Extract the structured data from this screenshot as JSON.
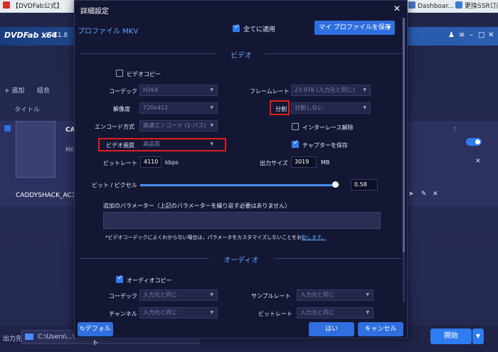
{
  "browser_tabs": [
    {
      "label": "【DVDFab公式】",
      "color": "#d93025"
    },
    {
      "label": "Dashboar...",
      "color": "#4a74c9"
    },
    {
      "label": "更換SSR订阅地",
      "color": "#3b7bd8"
    }
  ],
  "app": {
    "name": "DVDFab x64",
    "version": "12.0.1.8",
    "toolbar": {
      "add_label": "+ 追加",
      "merge_label": "結合"
    },
    "title_column": "タイトル",
    "job": {
      "short_name": "CA",
      "mk_label": "MK",
      "full_name": "CADDYSHACK_AC3_1",
      "side_number": "7"
    },
    "footer": {
      "output_label": "出力先",
      "path": "C:\\Users\\...\\Documents\\DVDFab\\DVDFab12\\",
      "start_label": "開始"
    }
  },
  "dialog": {
    "title": "詳細設定",
    "profile_label": "プロファイル MKV",
    "apply_all_label": "全てに適用",
    "apply_all_checked": true,
    "save_profile_label": "マイ プロファイルを保存",
    "video_section": "ビデオ",
    "video_copy_label": "ビデオコピー",
    "video_copy_checked": false,
    "codec_label": "コーデック",
    "codec_value": "H264",
    "frame_rate_label": "フレームレート",
    "frame_rate_value": "23.976 (入力元と同じ)",
    "resolution_label": "解像度",
    "resolution_value": "720x412",
    "split_label": "分割",
    "split_value": "分割しない",
    "encode_label": "エンコード方式",
    "encode_value": "高速エンコード (1-パス)",
    "deinterlace_label": "インターレース解除",
    "deinterlace_checked": false,
    "quality_label": "ビデオ画質",
    "quality_value": "高品質",
    "chapter_label": "チャプターを保存",
    "chapter_checked": true,
    "bitrate_label": "ビットレート",
    "bitrate_value": "4110",
    "bitrate_unit": "kbps",
    "output_size_label": "出力サイズ",
    "output_size_value": "3019",
    "output_size_unit": "MB",
    "bits_per_pixel_label": "ビット / ピクセル",
    "bits_per_pixel_value": "0.58",
    "bits_per_pixel_fraction": 0.98,
    "extra_params_label": "追加のパラメーター（上記のパラメーターを繰り返す必要はありません）",
    "extra_params_value": "",
    "note_text": "*ビデオコーデックによくわからない場合は，パラメータをカスタマイズしないことをお",
    "note_link": "勧します。",
    "audio_section": "オーディオ",
    "audio_copy_label": "オーディオコピー",
    "audio_copy_checked": true,
    "audio_codec_label": "コーデック",
    "audio_codec_value": "入力元と同じ",
    "sample_rate_label": "サンプルレート",
    "sample_rate_value": "入力元と同じ",
    "channel_label": "チャンネル",
    "channel_value": "入力元と同じ",
    "audio_bitrate_label": "ビットレート",
    "audio_bitrate_value": "入力元と同じ",
    "default_label": "デフォルト",
    "ok_label": "はい",
    "cancel_label": "キャンセル"
  },
  "colors": {
    "accent": "#2f6fe0",
    "link": "#5fa6ff",
    "highlight_box": "#e11d1d",
    "dialog_bg": "#141733"
  }
}
